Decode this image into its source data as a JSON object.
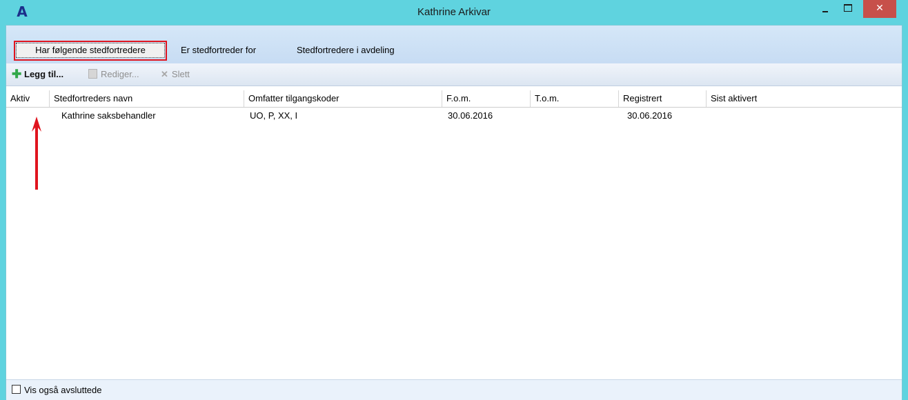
{
  "window": {
    "title": "Kathrine Arkivar",
    "app_icon_label": "A",
    "close_glyph": "✕"
  },
  "tabs": [
    {
      "label": "Har følgende stedfortredere",
      "active": true
    },
    {
      "label": "Er stedfortreder for"
    },
    {
      "label": "Stedfortredere i avdeling"
    }
  ],
  "toolbar": {
    "add_label": "Legg til...",
    "edit_label": "Rediger...",
    "delete_label": "Slett",
    "add_icon": "plus-icon",
    "edit_icon": "document-icon",
    "delete_icon": "x-icon"
  },
  "columns": [
    "Aktiv",
    "Stedfortreders navn",
    "Omfatter tilgangskoder",
    "F.o.m.",
    "T.o.m.",
    "Registrert",
    "Sist aktivert"
  ],
  "rows": [
    {
      "aktiv": "",
      "navn": "Kathrine saksbehandler",
      "koder": "UO, P, XX, I",
      "fom": "30.06.2016",
      "tom": "",
      "registrert": "30.06.2016",
      "sist_aktivert": ""
    }
  ],
  "footer": {
    "checkbox_label": "Vis også avsluttede",
    "checked": false
  },
  "colors": {
    "titlebar": "#5fd3df",
    "highlight": "#e0141e",
    "close_button": "#c7504a"
  }
}
